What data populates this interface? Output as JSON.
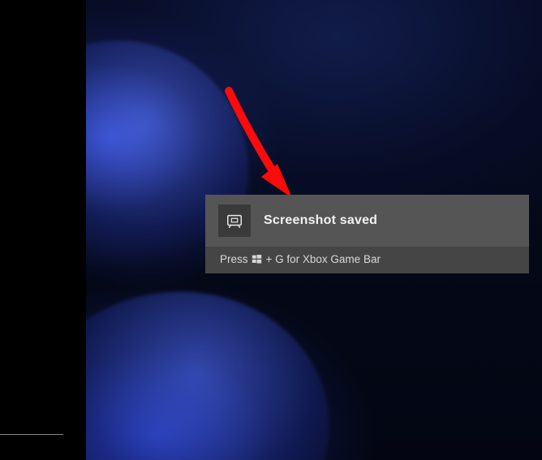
{
  "notification": {
    "title": "Screenshot saved",
    "hint_prefix": "Press",
    "hint_suffix": "+ G for Xbox Game Bar",
    "icon_name": "screenshot-icon",
    "key_icon_name": "windows-key-icon"
  },
  "annotation": {
    "arrow_color": "#ff0a0a"
  },
  "colors": {
    "toast_bg": "#454545",
    "toast_header_bg": "#555555",
    "toast_icon_box_bg": "#3a3a3a",
    "title_color": "#f2f2f2",
    "hint_color": "#d8d8d8"
  }
}
